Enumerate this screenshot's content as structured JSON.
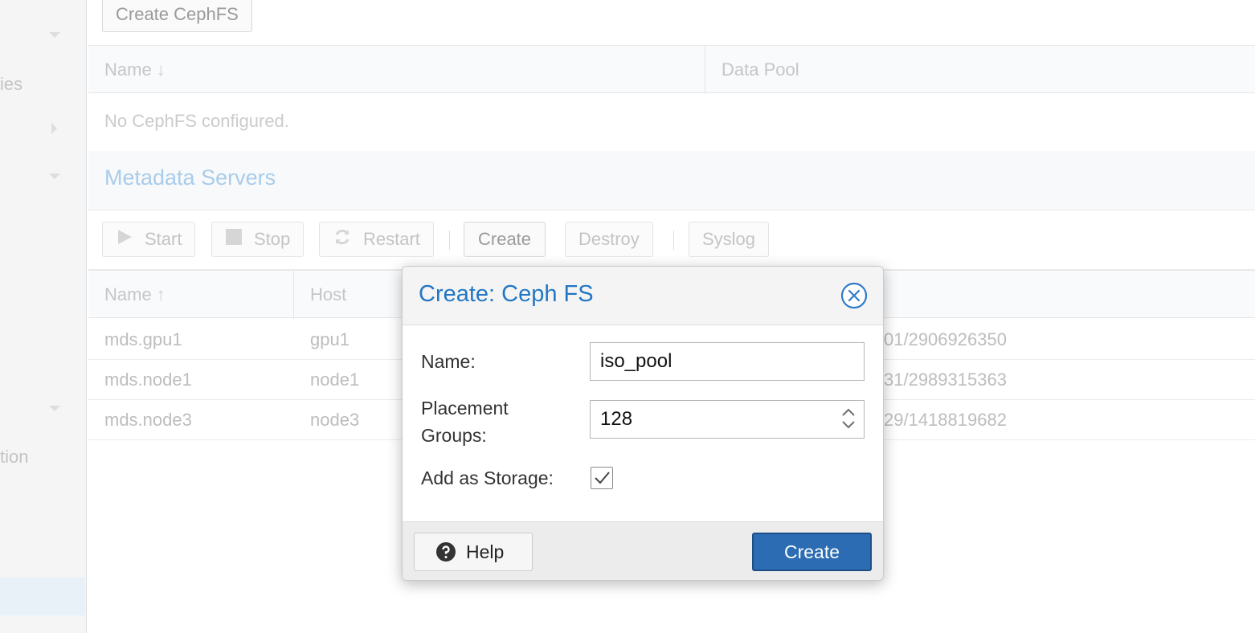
{
  "sidebar": {
    "item_ies": "ies",
    "item_tion": "tion"
  },
  "cephfs": {
    "create_button": "Create CephFS",
    "columns": [
      "Name",
      "Data Pool"
    ],
    "empty_text": "No CephFS configured."
  },
  "mds": {
    "section_title": "Metadata Servers",
    "toolbar": {
      "start": "Start",
      "stop": "Stop",
      "restart": "Restart",
      "create": "Create",
      "destroy": "Destroy",
      "syslog": "Syslog"
    },
    "columns": [
      "Name",
      "Host"
    ],
    "rows": [
      {
        "name": "mds.gpu1",
        "host": "gpu1",
        "addr": "01/2906926350"
      },
      {
        "name": "mds.node1",
        "host": "node1",
        "addr": "31/2989315363"
      },
      {
        "name": "mds.node3",
        "host": "node3",
        "addr": "29/1418819682"
      }
    ]
  },
  "dialog": {
    "title": "Create: Ceph FS",
    "name_label": "Name:",
    "name_value": "iso_pool",
    "pg_label_line1": "Placement",
    "pg_label_line2": "Groups:",
    "pg_value": "128",
    "storage_label": "Add as Storage:",
    "storage_checked": true,
    "help_label": "Help",
    "create_label": "Create"
  },
  "colors": {
    "accent": "#2277c4",
    "primary_button": "#2b6cb2",
    "faded_text": "#c4c4c4"
  }
}
